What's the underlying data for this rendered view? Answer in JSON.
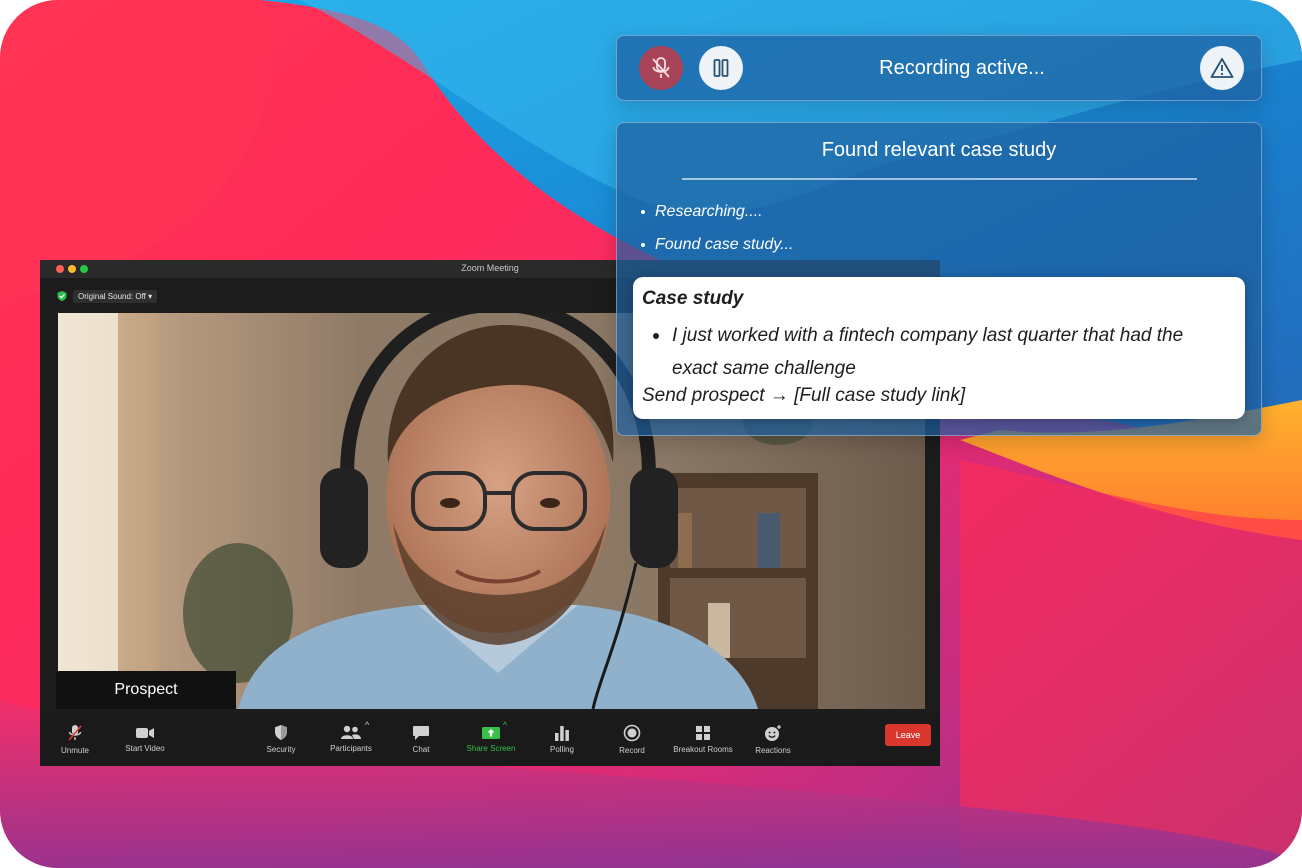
{
  "colors": {
    "accent_blue": "#1e5fa0",
    "leave_red": "#d9362e",
    "mute_red": "#a94458",
    "share_green": "#36c04a"
  },
  "recording_bar": {
    "status": "Recording active...",
    "icons": [
      "mic-off-icon",
      "pause-icon",
      "warning-icon"
    ]
  },
  "assistant_panel": {
    "title": "Found relevant case study",
    "progress": [
      "Researching....",
      "Found case study..."
    ],
    "case_card": {
      "heading": "Case study",
      "bullet": "I just worked with a fintech company last quarter that had the exact same challenge",
      "action": "Send prospect → [Full case study link]"
    }
  },
  "zoom": {
    "window_title": "Zoom Meeting",
    "original_sound": "Original Sound: Off",
    "participant_name": "Prospect",
    "toolbar": {
      "unmute": "Unmute",
      "start_video": "Start Video",
      "security": "Security",
      "participants": "Participants",
      "chat": "Chat",
      "share_screen": "Share Screen",
      "polling": "Polling",
      "record": "Record",
      "breakout_rooms": "Breakout Rooms",
      "reactions": "Reactions",
      "leave": "Leave"
    }
  }
}
